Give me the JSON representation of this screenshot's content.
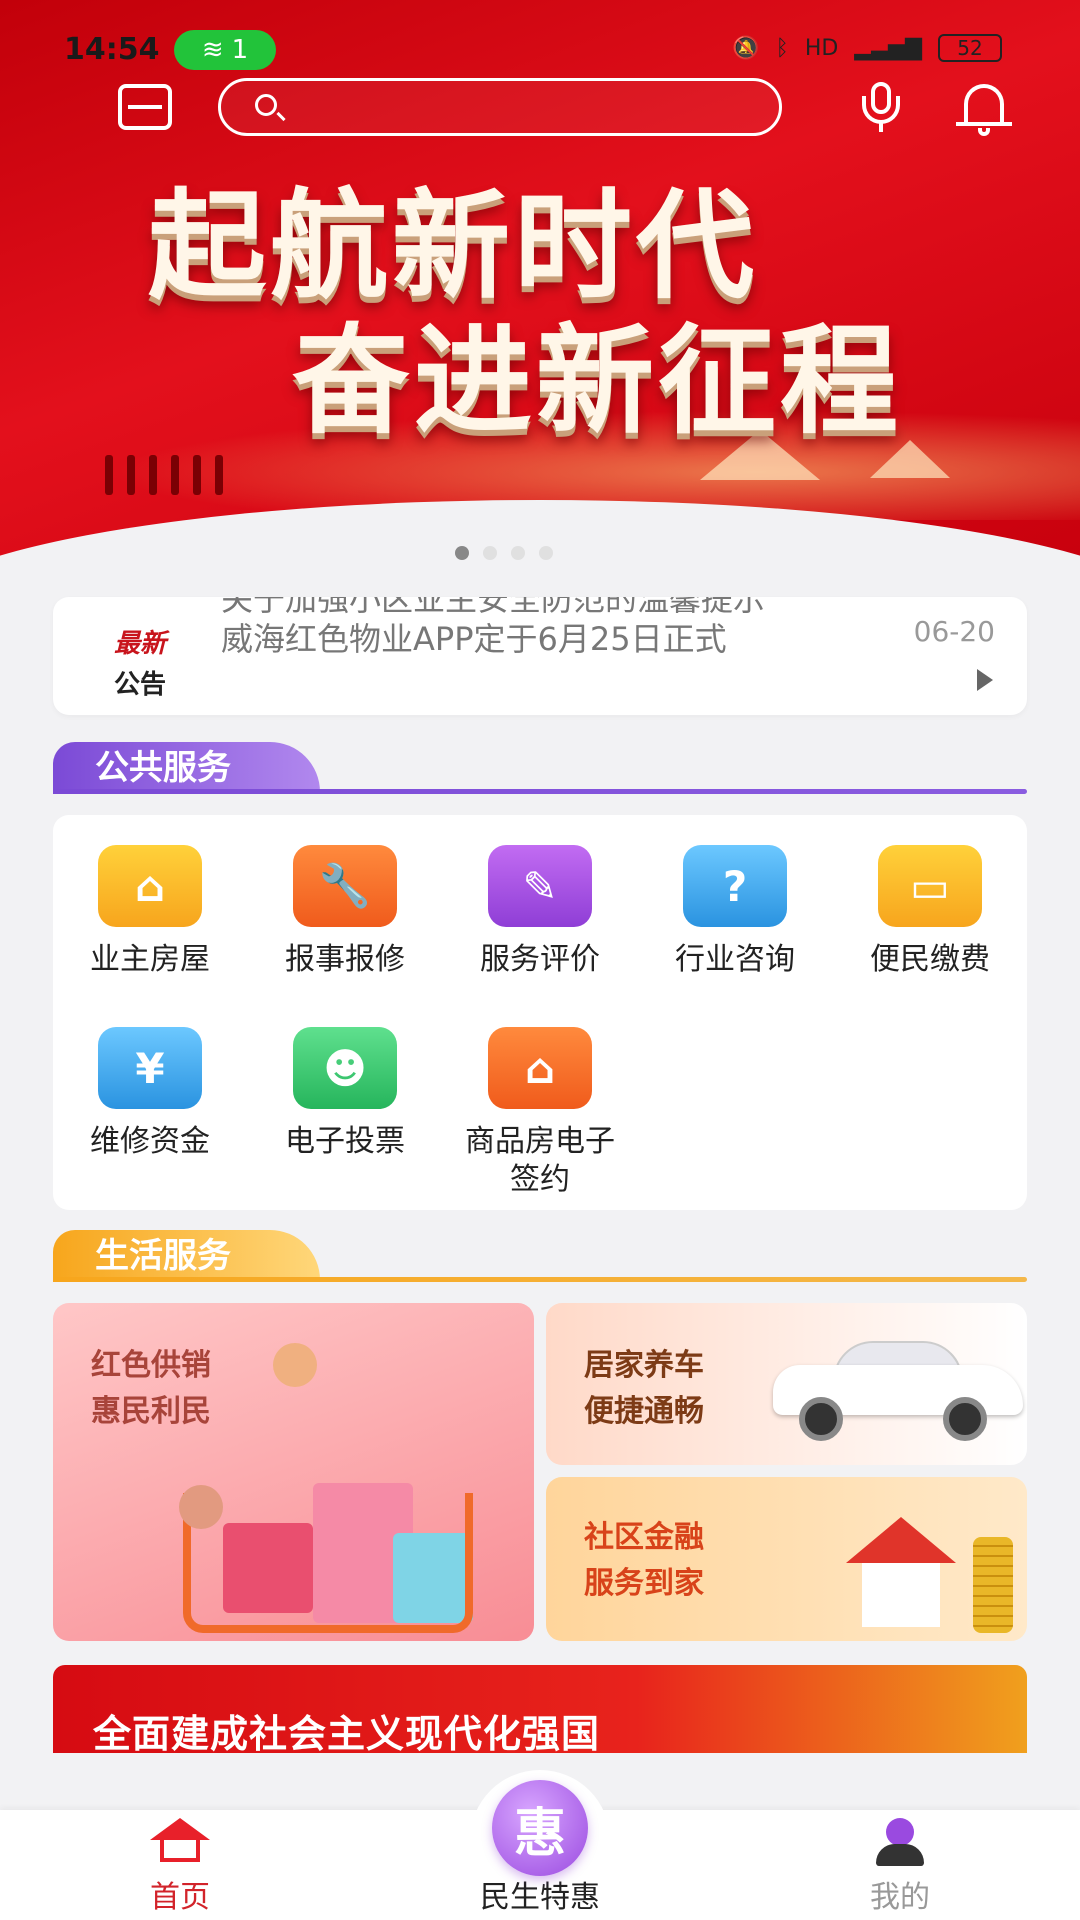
{
  "status_bar": {
    "time": "14:54",
    "hotspot_count": "1",
    "battery": "52"
  },
  "header": {
    "search_placeholder": "",
    "banner_line1": "起航新时代",
    "banner_line2": "奋进新征程",
    "carousel_count": 4,
    "carousel_active": 0
  },
  "notice": {
    "tag_line1": "最新",
    "tag_line2": "公告",
    "items": [
      "关于加强小区业主安全防范的温馨提示",
      "威海红色物业APP定于6月25日正式"
    ],
    "date": "06-20"
  },
  "public_services": {
    "title": "公共服务",
    "items": [
      {
        "label": "业主房屋",
        "icon": "house-icon",
        "color": "#f7a51d"
      },
      {
        "label": "报事报修",
        "icon": "wrench-icon",
        "color": "#f05b1c"
      },
      {
        "label": "服务评价",
        "icon": "clipboard-edit-icon",
        "color": "#8f3ed6"
      },
      {
        "label": "行业咨询",
        "icon": "consult-question-icon",
        "color": "#2a93e0"
      },
      {
        "label": "便民缴费",
        "icon": "card-payment-icon",
        "color": "#f7a51d"
      },
      {
        "label": "维修资金",
        "icon": "yuan-coin-icon",
        "color": "#2a93e0"
      },
      {
        "label": "电子投票",
        "icon": "vote-person-icon",
        "color": "#26b55c"
      },
      {
        "label": "商品房电子签约",
        "icon": "house-sign-icon",
        "color": "#f05b1c"
      }
    ]
  },
  "life_services": {
    "title": "生活服务",
    "cards": [
      {
        "line1": "红色供销",
        "line2": "惠民利民"
      },
      {
        "line1": "居家养车",
        "line2": "便捷通畅"
      },
      {
        "line1": "社区金融",
        "line2": "服务到家"
      }
    ]
  },
  "promo": {
    "text": "全面建成社会主义现代化强国"
  },
  "bottom_nav": {
    "home": "首页",
    "center": "民生特惠",
    "center_glyph": "惠",
    "mine": "我的"
  },
  "colors": {
    "brand_red": "#d2232a",
    "purple": "#7b4ad6",
    "orange": "#f7a61c"
  }
}
